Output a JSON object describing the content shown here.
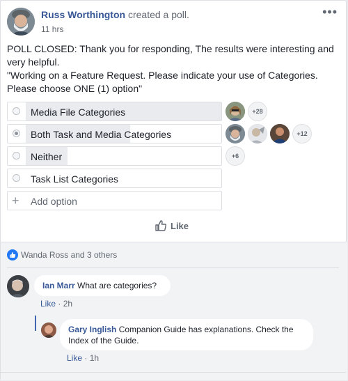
{
  "post": {
    "author": "Russ Worthington",
    "action": "created a poll.",
    "timestamp": "11 hrs",
    "more_label": "•••",
    "text_line1": "POLL CLOSED: Thank you for responding, The results were interesting and very helpful.",
    "text_line2": "\"Working on a Feature Request. Please indicate your use of Categories. Please choose ONE (1) option\""
  },
  "poll": {
    "options": [
      {
        "label": "Media File Categories",
        "fill_fraction": 0.95,
        "selected": false,
        "more_voters": "+28"
      },
      {
        "label": "Both Task and Media Categories",
        "fill_fraction": 0.5,
        "selected": true,
        "more_voters": "+12"
      },
      {
        "label": "Neither",
        "fill_fraction": 0.2,
        "selected": false,
        "more_voters": "+6"
      },
      {
        "label": "Task List Categories",
        "fill_fraction": 0,
        "selected": false
      }
    ],
    "add_option_placeholder": "Add option"
  },
  "actions": {
    "like_label": "Like"
  },
  "reactions": {
    "summary": "Wanda Ross and 3 others"
  },
  "comments": [
    {
      "author": "Ian Marr",
      "text": "What are categories?",
      "like_label": "Like",
      "separator": "·",
      "time": "2h",
      "replies": [
        {
          "author": "Gary Inglish",
          "text": "Companion Guide has explanations. Check the Index of the Guide.",
          "like_label": "Like",
          "separator": "·",
          "time": "1h"
        }
      ]
    }
  ],
  "colors": {
    "link": "#385898",
    "accent": "#4267b2",
    "like_badge": "#2078f4"
  },
  "icons": [
    "user-avatar-icon",
    "like-thumb-icon",
    "radio-icon",
    "plus-icon",
    "more-options-icon"
  ]
}
